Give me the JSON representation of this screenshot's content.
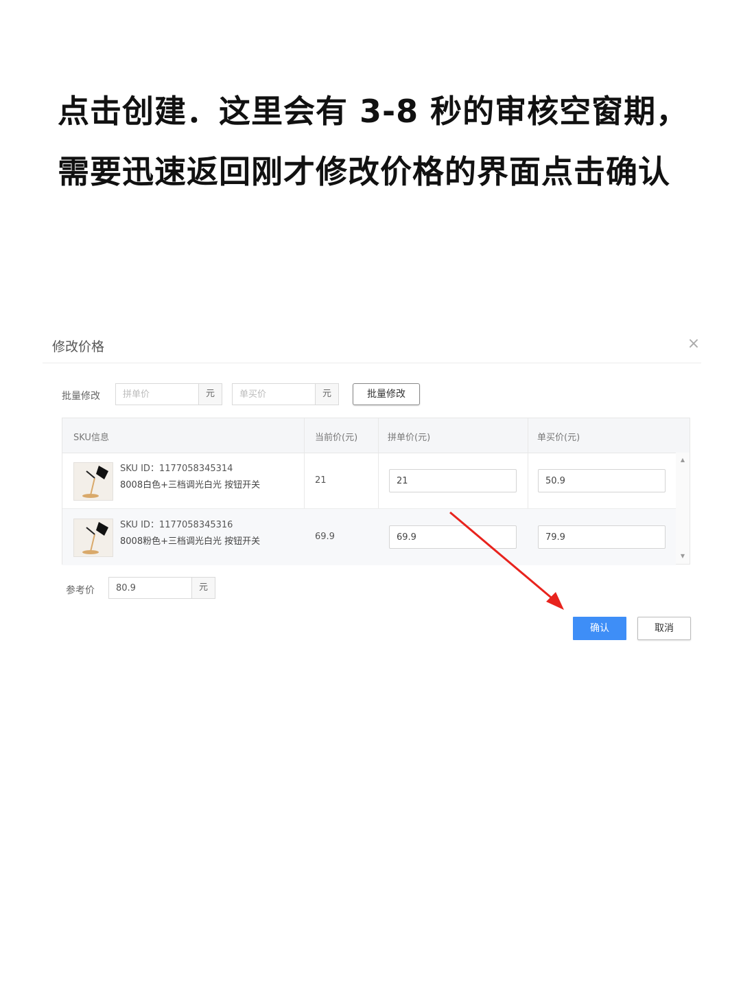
{
  "instruction": {
    "line1": "点击创建．这里会有 3-8 秒的审核空窗期，",
    "line2": "需要迅速返回刚才修改价格的界面点击确认"
  },
  "dialog": {
    "title": "修改价格",
    "close_icon": "close-icon",
    "batch": {
      "label": "批量修改",
      "group_price_placeholder": "拼单价",
      "group_price_unit": "元",
      "single_price_placeholder": "单买价",
      "single_price_unit": "元",
      "button_label": "批量修改"
    },
    "table": {
      "headers": [
        "SKU信息",
        "当前价(元)",
        "拼单价(元)",
        "单买价(元)"
      ],
      "rows": [
        {
          "sku_id": "SKU ID：1177058345314",
          "name": "8008白色+三档调光白光 按钮开关",
          "current_price": "21",
          "group_price": "21",
          "single_price": "50.9"
        },
        {
          "sku_id": "SKU ID：1177058345316",
          "name": "8008粉色+三档调光白光 按钮开关",
          "current_price": "69.9",
          "group_price": "69.9",
          "single_price": "79.9"
        }
      ]
    },
    "reference": {
      "label": "参考价",
      "value": "80.9",
      "unit": "元"
    },
    "confirm_label": "确认",
    "cancel_label": "取消"
  },
  "annotation": {
    "arrow_color": "#e8231d"
  },
  "colors": {
    "primary": "#3e8ef7"
  }
}
